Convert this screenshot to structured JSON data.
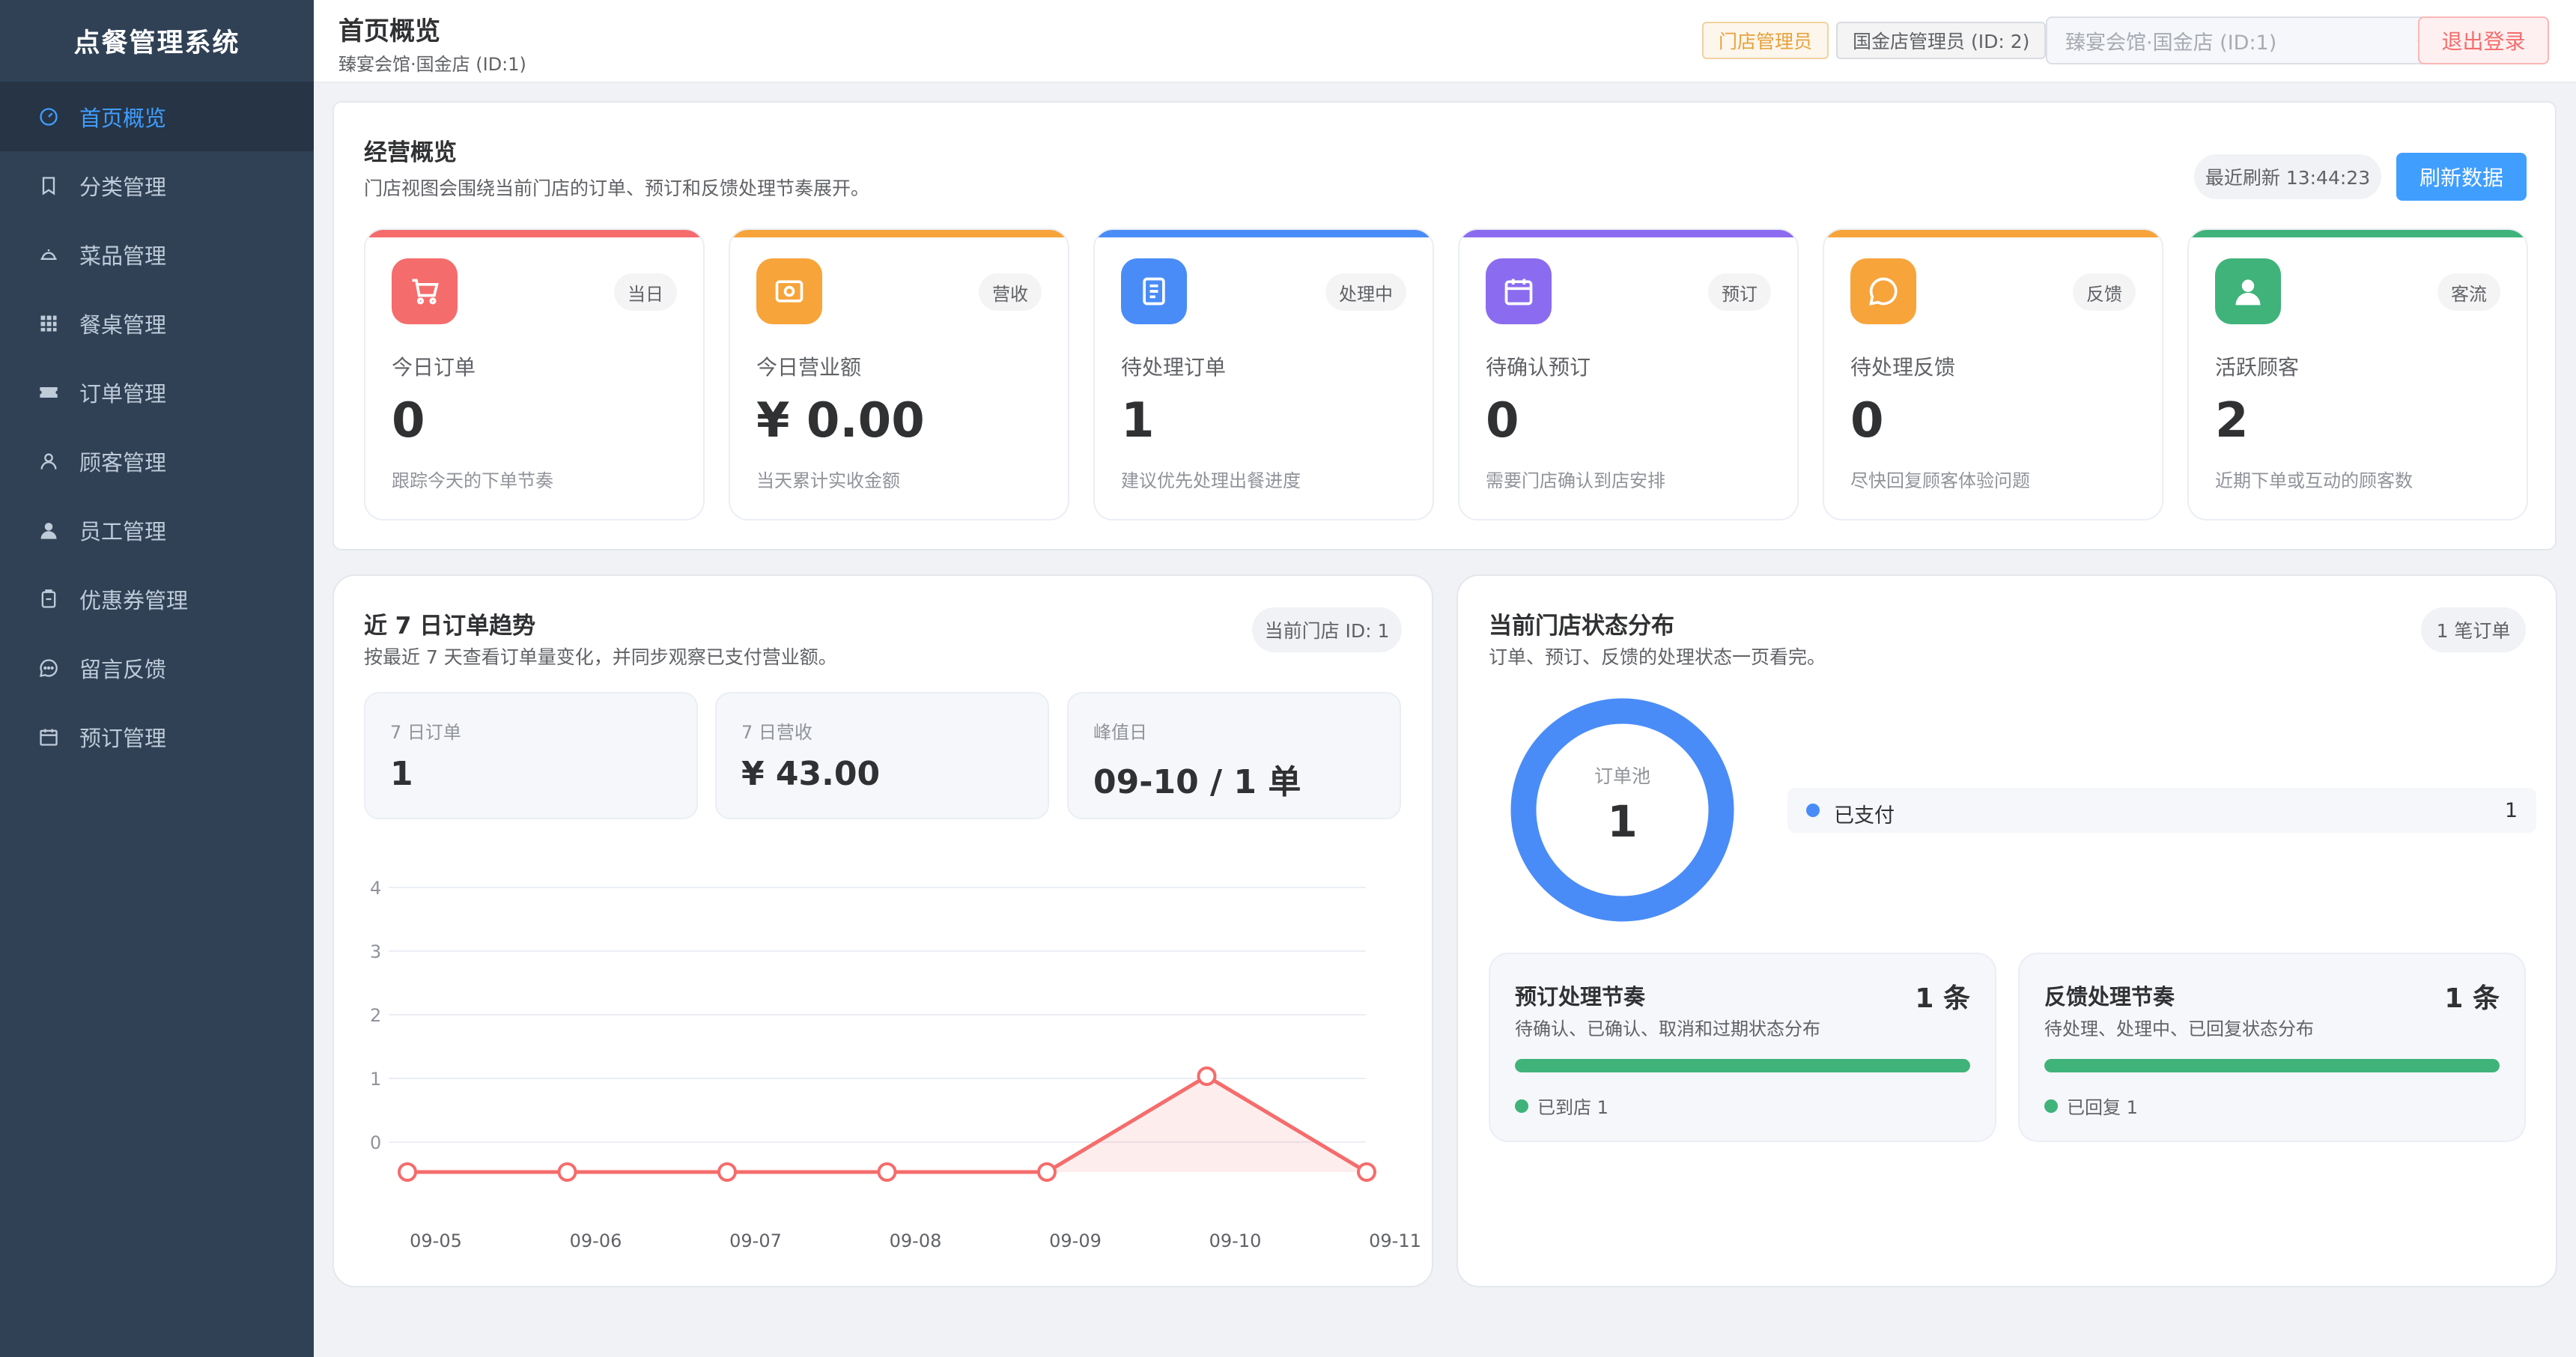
{
  "sidebar": {
    "title": "点餐管理系统",
    "items": [
      {
        "label": "首页概览",
        "icon": "dashboard-icon",
        "active": true
      },
      {
        "label": "分类管理",
        "icon": "bookmark-icon"
      },
      {
        "label": "菜品管理",
        "icon": "dish-icon"
      },
      {
        "label": "餐桌管理",
        "icon": "grid-icon"
      },
      {
        "label": "订单管理",
        "icon": "ticket-icon"
      },
      {
        "label": "顾客管理",
        "icon": "user-outline-icon"
      },
      {
        "label": "员工管理",
        "icon": "user-filled-icon"
      },
      {
        "label": "优惠券管理",
        "icon": "coupon-icon"
      },
      {
        "label": "留言反馈",
        "icon": "chat-icon"
      },
      {
        "label": "预订管理",
        "icon": "calendar-icon"
      }
    ]
  },
  "header": {
    "title": "首页概览",
    "subtitle": "臻宴会馆·国金店 (ID:1)",
    "role_tag": "门店管理员",
    "admin_tag": "国金店管理员 (ID: 2)",
    "store_select": "臻宴会馆·国金店 (ID:1)",
    "logout": "退出登录"
  },
  "overview": {
    "title": "经营概览",
    "subtitle": "门店视图会围绕当前门店的订单、预订和反馈处理节奏展开。",
    "last_refresh": "最近刷新 13:44:23",
    "refresh_button": "刷新数据",
    "cards": [
      {
        "badge": "当日",
        "label": "今日订单",
        "value": "0",
        "note": "跟踪今天的下单节奏",
        "color": "#f56c6c",
        "icon": "cart-icon"
      },
      {
        "badge": "营收",
        "label": "今日营业额",
        "value": "¥ 0.00",
        "note": "当天累计实收金额",
        "color": "#f7a43a",
        "icon": "money-icon"
      },
      {
        "badge": "处理中",
        "label": "待处理订单",
        "value": "1",
        "note": "建议优先处理出餐进度",
        "color": "#4a8cf7",
        "icon": "document-icon"
      },
      {
        "badge": "预订",
        "label": "待确认预订",
        "value": "0",
        "note": "需要门店确认到店安排",
        "color": "#8b6cf0",
        "icon": "calendar-icon"
      },
      {
        "badge": "反馈",
        "label": "待处理反馈",
        "value": "0",
        "note": "尽快回复顾客体验问题",
        "color": "#f7a43a",
        "icon": "chat-icon"
      },
      {
        "badge": "客流",
        "label": "活跃顾客",
        "value": "2",
        "note": "近期下单或互动的顾客数",
        "color": "#3fb37a",
        "icon": "user-icon"
      }
    ]
  },
  "trend": {
    "title": "近 7 日订单趋势",
    "subtitle": "按最近 7 天查看订单量变化，并同步观察已支付营业额。",
    "store_pill": "当前门店 ID: 1",
    "stats": [
      {
        "label": "7 日订单",
        "value": "1"
      },
      {
        "label": "7 日营收",
        "value": "¥ 43.00"
      },
      {
        "label": "峰值日",
        "value": "09-10 / 1 单"
      }
    ]
  },
  "chart_data": {
    "type": "line",
    "categories": [
      "09-05",
      "09-06",
      "09-07",
      "09-08",
      "09-09",
      "09-10",
      "09-11"
    ],
    "values": [
      0,
      0,
      0,
      0,
      0,
      1,
      0
    ],
    "y_ticks": [
      "4",
      "3",
      "2",
      "1",
      "0"
    ],
    "ylim": [
      0,
      4
    ],
    "grid": true,
    "color": "#f56c6c"
  },
  "status": {
    "title": "当前门店状态分布",
    "subtitle": "订单、预订、反馈的处理状态一页看完。",
    "pill": "1 笔订单",
    "donut_label": "订单池",
    "donut_value": "1",
    "legend_label": "已支付",
    "legend_value": "1",
    "legend_color": "#4a8cf7",
    "reservation": {
      "title": "预订处理节奏",
      "count": "1 条",
      "subtitle": "待确认、已确认、取消和过期状态分布",
      "legend": "已到店 1",
      "progress": 1
    },
    "feedback": {
      "title": "反馈处理节奏",
      "count": "1 条",
      "subtitle": "待处理、处理中、已回复状态分布",
      "legend": "已回复 1",
      "progress": 1
    }
  }
}
